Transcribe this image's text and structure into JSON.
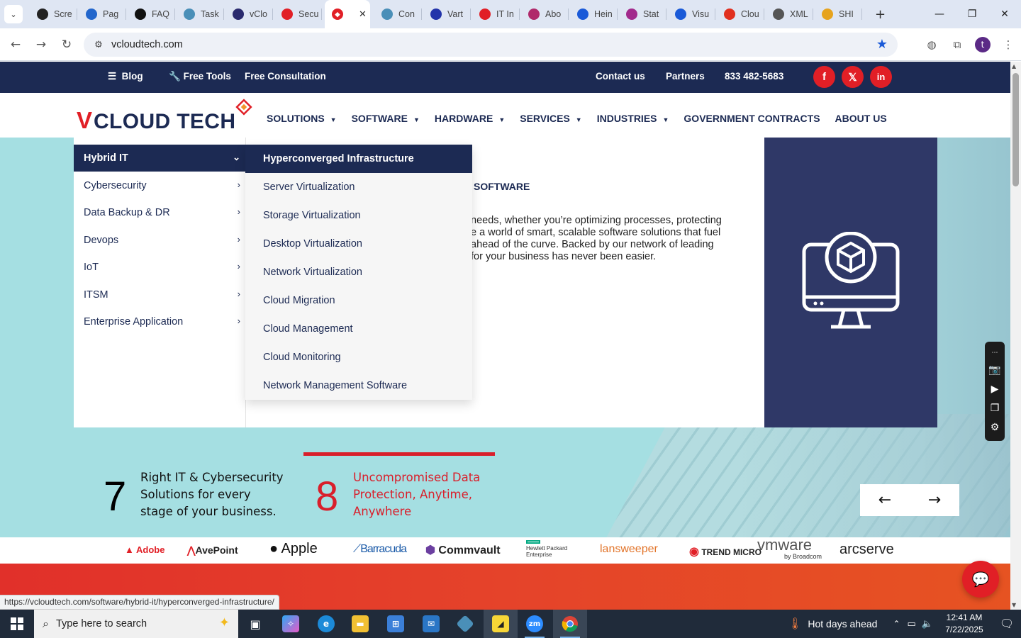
{
  "browser": {
    "tabs": [
      {
        "label": "Scre",
        "icon": "github-icon",
        "color": "#222222"
      },
      {
        "label": "Pag",
        "icon": "speedometer-icon",
        "color": "#2266cc"
      },
      {
        "label": "FAQ",
        "icon": "openai-icon",
        "color": "#111111"
      },
      {
        "label": "Task",
        "icon": "diamond-icon",
        "color": "#4a8fb8"
      },
      {
        "label": "vClo",
        "icon": "v-icon",
        "color": "#2a2a6e"
      },
      {
        "label": "Secu",
        "icon": "vcloud-icon",
        "color": "#e11f26"
      },
      {
        "label": "Con",
        "icon": "diamond-icon",
        "color": "#4a8fb8"
      },
      {
        "label": "Vart",
        "icon": "x-icon",
        "color": "#2233aa"
      },
      {
        "label": "IT In",
        "icon": "vcloud-icon",
        "color": "#e11f26"
      },
      {
        "label": "Abo",
        "icon": "wave-icon",
        "color": "#b0296b"
      },
      {
        "label": "Hein",
        "icon": "scale-icon",
        "color": "#1a5ad8"
      },
      {
        "label": "Stat",
        "icon": "arrow-icon",
        "color": "#a22a8c"
      },
      {
        "label": "Visu",
        "icon": "pulse-icon",
        "color": "#1a5ad8"
      },
      {
        "label": "Clou",
        "icon": "slash-icon",
        "color": "#e1301f"
      },
      {
        "label": "XML",
        "icon": "globe-icon",
        "color": "#555555"
      },
      {
        "label": "SHI",
        "icon": "ring-icon",
        "color": "#e6a31e"
      }
    ],
    "active_tab_index": 6,
    "url": "vcloudtech.com",
    "profile_initial": "t"
  },
  "site": {
    "topbar": {
      "blog": "Blog",
      "free_tools": "Free Tools",
      "free_consultation": "Free Consultation",
      "contact": "Contact us",
      "partners": "Partners",
      "phone": "833 482-5683",
      "social": [
        "f",
        "𝕏",
        "in"
      ]
    },
    "logo": {
      "text_v": "V",
      "text_rest": "CLOUD TECH",
      "alt": "VCLOUD TECH"
    },
    "nav": [
      {
        "label": "SOLUTIONS",
        "dropdown": true
      },
      {
        "label": "SOFTWARE",
        "dropdown": true
      },
      {
        "label": "HARDWARE",
        "dropdown": true
      },
      {
        "label": "SERVICES",
        "dropdown": true
      },
      {
        "label": "INDUSTRIES",
        "dropdown": true
      },
      {
        "label": "GOVERNMENT CONTRACTS",
        "dropdown": false
      },
      {
        "label": "ABOUT US",
        "dropdown": false
      }
    ],
    "submenu_left": [
      {
        "label": "Hybrid IT",
        "active": true,
        "chev": "⌄"
      },
      {
        "label": "Cybersecurity",
        "active": false,
        "chev": "›"
      },
      {
        "label": "Data Backup & DR",
        "active": false,
        "chev": "›"
      },
      {
        "label": "Devops",
        "active": false,
        "chev": "›"
      },
      {
        "label": "IoT",
        "active": false,
        "chev": "›"
      },
      {
        "label": "ITSM",
        "active": false,
        "chev": "›"
      },
      {
        "label": "Enterprise Application",
        "active": false,
        "chev": "›"
      }
    ],
    "submenu_right": [
      {
        "label": "Hyperconverged Infrastructure",
        "active": true
      },
      {
        "label": "Server Virtualization",
        "active": false
      },
      {
        "label": "Storage Virtualization",
        "active": false
      },
      {
        "label": "Desktop Virtualization",
        "active": false
      },
      {
        "label": "Network Virtualization",
        "active": false
      },
      {
        "label": "Cloud Migration",
        "active": false
      },
      {
        "label": "Cloud Management",
        "active": false
      },
      {
        "label": "Cloud Monitoring",
        "active": false
      },
      {
        "label": "Network Management Software",
        "active": false
      }
    ],
    "content": {
      "title": "SOFTWARE",
      "lines": [
        "needs, whether you’re optimizing processes, protecting",
        "e a world of smart, scalable software solutions that fuel",
        "ahead of the curve. Backed by our network of leading",
        "for your business has never been easier."
      ]
    },
    "stats": [
      {
        "number": "7",
        "text": [
          "Right IT & Cybersecurity",
          "Solutions for every",
          "stage of your business."
        ],
        "color": "#111111"
      },
      {
        "number": "8",
        "text": [
          "Uncompromised Data",
          "Protection, Anytime,",
          "Anywhere"
        ],
        "color": "#d91f2b"
      }
    ],
    "arrows": {
      "prev": "←",
      "next": "→"
    },
    "brands": [
      "Adobe",
      "AvePoint",
      "Apple",
      "Barracuda",
      "Commvault",
      "Hewlett Packard Enterprise",
      "lansweeper",
      "TREND MICRO",
      "vmware",
      "by Broadcom",
      "arcserve"
    ],
    "status_url": "https://vcloudtech.com/software/hybrid-it/hyperconverged-infrastructure/"
  },
  "taskbar": {
    "search_placeholder": "Type here to search",
    "weather": "Hot days ahead",
    "time": "12:41 AM",
    "date": "7/22/2025"
  },
  "colors": {
    "navy": "#1c2a53",
    "brand_red": "#e11f26",
    "hero_teal": "#a5dfe2",
    "panel_navy": "#2f3867"
  }
}
